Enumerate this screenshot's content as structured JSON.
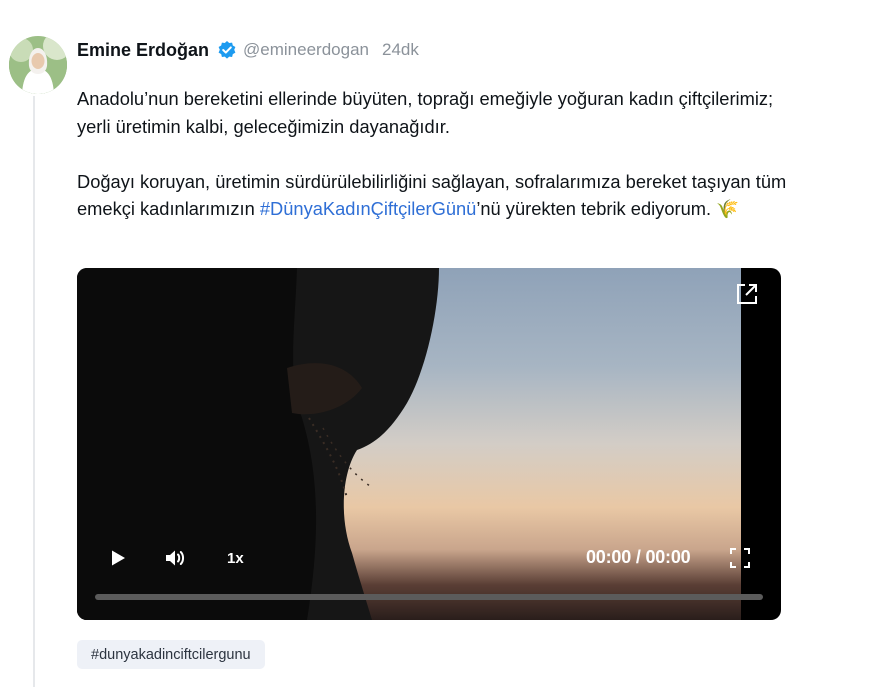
{
  "post": {
    "author_name": "Emine Erdoğan",
    "handle": "@emineerdogan",
    "time": "24dk",
    "paragraph1": "Anadolu’nun bereketini ellerinde büyüten, toprağı emeğiyle yoğuran kadın çiftçilerimiz; yerli üretimin kalbi, geleceğimizin dayanağıdır.",
    "paragraph2_before": "Doğayı koruyan, üretimin sürdürülebilirliğini sağlayan, sofralarımıza bereket taşıyan tüm emekçi kadınlarımızın ",
    "paragraph2_hashtag": "#DünyaKadınÇiftçilerGünü",
    "paragraph2_after": "’nü yürekten tebrik ediyorum. ",
    "emoji": "🌾"
  },
  "video": {
    "speed": "1x",
    "timecode": "00:00 / 00:00",
    "progress": 0
  },
  "tags": [
    "#dunyakadinciftcilergunu"
  ],
  "colors": {
    "accent_link": "#2f6fd6",
    "verified_badge": "#1d9bf0",
    "muted_text": "#8b929a",
    "tag_background": "#eef1f7"
  },
  "icons": {
    "verified": "verified-badge-icon",
    "open": "external-link-icon",
    "play": "play-icon",
    "volume": "volume-icon",
    "fullscreen": "fullscreen-icon"
  }
}
